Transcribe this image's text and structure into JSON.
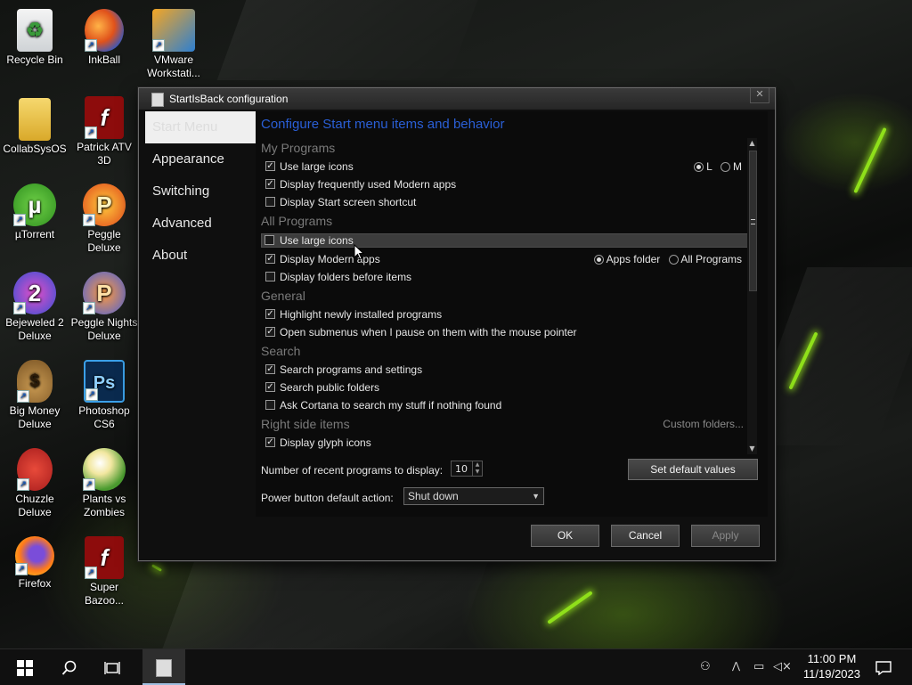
{
  "desktop": {
    "icons": [
      {
        "label": "Recycle Bin"
      },
      {
        "label": "InkBall"
      },
      {
        "label": "VMware Workstati..."
      },
      {
        "label": "CollabSysOS"
      },
      {
        "label": "Patrick ATV 3D"
      },
      {
        "label": "µTorrent"
      },
      {
        "label": "Peggle Deluxe"
      },
      {
        "label": "Bejeweled 2 Deluxe"
      },
      {
        "label": "Peggle Nights Deluxe"
      },
      {
        "label": "Big Money Deluxe"
      },
      {
        "label": "Photoshop CS6"
      },
      {
        "label": "Chuzzle Deluxe"
      },
      {
        "label": "Plants vs Zombies"
      },
      {
        "label": "Firefox"
      },
      {
        "label": "Super Bazoo..."
      }
    ]
  },
  "window": {
    "title": "StartIsBack configuration",
    "close_glyph": "✕",
    "nav": [
      "Start Menu",
      "Appearance",
      "Switching",
      "Advanced",
      "About"
    ],
    "heading": "Configure Start menu items and behavior",
    "sections": {
      "my_programs": {
        "title": "My Programs",
        "items": [
          {
            "label": "Use large icons",
            "checked": true
          },
          {
            "label": "Display frequently used Modern apps",
            "checked": true
          },
          {
            "label": "Display Start screen shortcut",
            "checked": false
          }
        ],
        "size_options": [
          "L",
          "M"
        ],
        "size_selected": "L"
      },
      "all_programs": {
        "title": "All Programs",
        "items": [
          {
            "label": "Use large icons",
            "checked": false
          },
          {
            "label": "Display Modern apps",
            "checked": true
          },
          {
            "label": "Display folders before items",
            "checked": false
          }
        ],
        "modern_options": [
          "Apps folder",
          "All Programs"
        ],
        "modern_selected": "Apps folder"
      },
      "general": {
        "title": "General",
        "items": [
          {
            "label": "Highlight newly installed programs",
            "checked": true
          },
          {
            "label": "Open submenus when I pause on them with the mouse pointer",
            "checked": true
          }
        ]
      },
      "search": {
        "title": "Search",
        "items": [
          {
            "label": "Search programs and settings",
            "checked": true
          },
          {
            "label": "Search public folders",
            "checked": true
          },
          {
            "label": "Ask Cortana to search my stuff if nothing found",
            "checked": false
          }
        ]
      },
      "right_side": {
        "title": "Right side items",
        "link": "Custom folders...",
        "items": [
          {
            "label": "Display glyph icons",
            "checked": true
          }
        ]
      }
    },
    "recent_label": "Number of recent programs to display:",
    "recent_value": "10",
    "set_default_label": "Set default values",
    "power_label": "Power button default action:",
    "power_value": "Shut down",
    "ok_label": "OK",
    "cancel_label": "Cancel",
    "apply_label": "Apply"
  },
  "taskbar": {
    "time": "11:00 PM",
    "date": "11/19/2023"
  },
  "colors": {
    "heading_accent": "#2a5fd6",
    "glow": "#8fe01a"
  }
}
